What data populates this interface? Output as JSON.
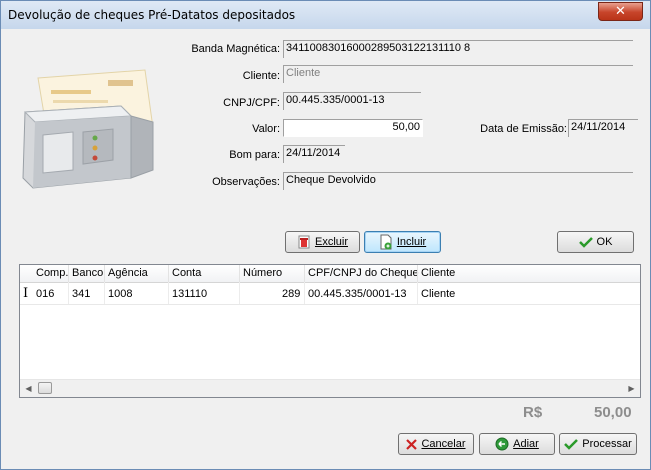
{
  "window": {
    "title": "Devolução de cheques Pré-Datatos depositados",
    "close_glyph": "✕"
  },
  "form": {
    "banda_label": "Banda Magnética:",
    "banda_value": "34110083016000289503122131110 8",
    "cliente_label": "Cliente:",
    "cliente_placeholder": "Cliente",
    "cnpj_label": "CNPJ/CPF:",
    "cnpj_value": "00.445.335/0001-13",
    "valor_label": "Valor:",
    "valor_value": "50,00",
    "emissao_label": "Data de Emissão:",
    "emissao_value": "24/11/2014",
    "bom_label": "Bom para:",
    "bom_value": "24/11/2014",
    "obs_label": "Observações:",
    "obs_value": "Cheque Devolvido"
  },
  "buttons": {
    "excluir": "Excluir",
    "incluir": "Incluir",
    "ok": "OK",
    "cancelar": "Cancelar",
    "adiar": "Adiar",
    "processar": "Processar"
  },
  "grid": {
    "columns": [
      "Comp.",
      "Banco",
      "Agência",
      "Conta",
      "Número",
      "CPF/CNPJ do Cheque",
      "Cliente"
    ],
    "rows": [
      [
        "016",
        "341",
        "1008",
        "131110",
        "289",
        "00.445.335/0001-13",
        "Cliente"
      ]
    ]
  },
  "totals": {
    "currency": "R$",
    "amount": "50,00"
  },
  "colors": {
    "accent": "#3c7fb1",
    "ok_check": "#2a9a2a",
    "cancel_x": "#cc2222"
  }
}
